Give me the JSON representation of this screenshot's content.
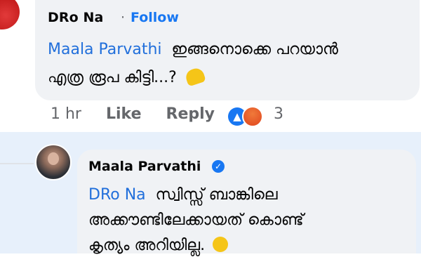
{
  "comment": {
    "author": "DRo Na",
    "separator": "·",
    "follow_label": "Follow",
    "mention": "Maala Parvathi",
    "text_line1": "ഇങ്ങനൊക്കെ പറയാൻ",
    "text_line2": "എത്ര രൂപ കിട്ടി...?",
    "time": "1 hr",
    "like_label": "Like",
    "reply_label": "Reply",
    "reaction_count": "3",
    "reaction_icons": [
      "like-icon",
      "angry-icon"
    ],
    "emoji": "pinching-hand-emoji"
  },
  "reply": {
    "author": "Maala Parvathi",
    "verified_icon": "verified-badge-icon",
    "mention": "DRo Na",
    "text_line1": "സ്വിസ്സ് ബാങ്കിലെ",
    "text_line2": "അക്കൗണ്ടിലേക്കായത് കൊണ്ട്",
    "text_line3": "കൃത്യം അറിയില്ല.",
    "emoji": "smirk-emoji"
  },
  "colors": {
    "link_blue": "#1877f2",
    "mention_blue": "#216fdb",
    "bubble_bg": "#f0f2f5",
    "reply_highlight": "#e7f0fb"
  }
}
